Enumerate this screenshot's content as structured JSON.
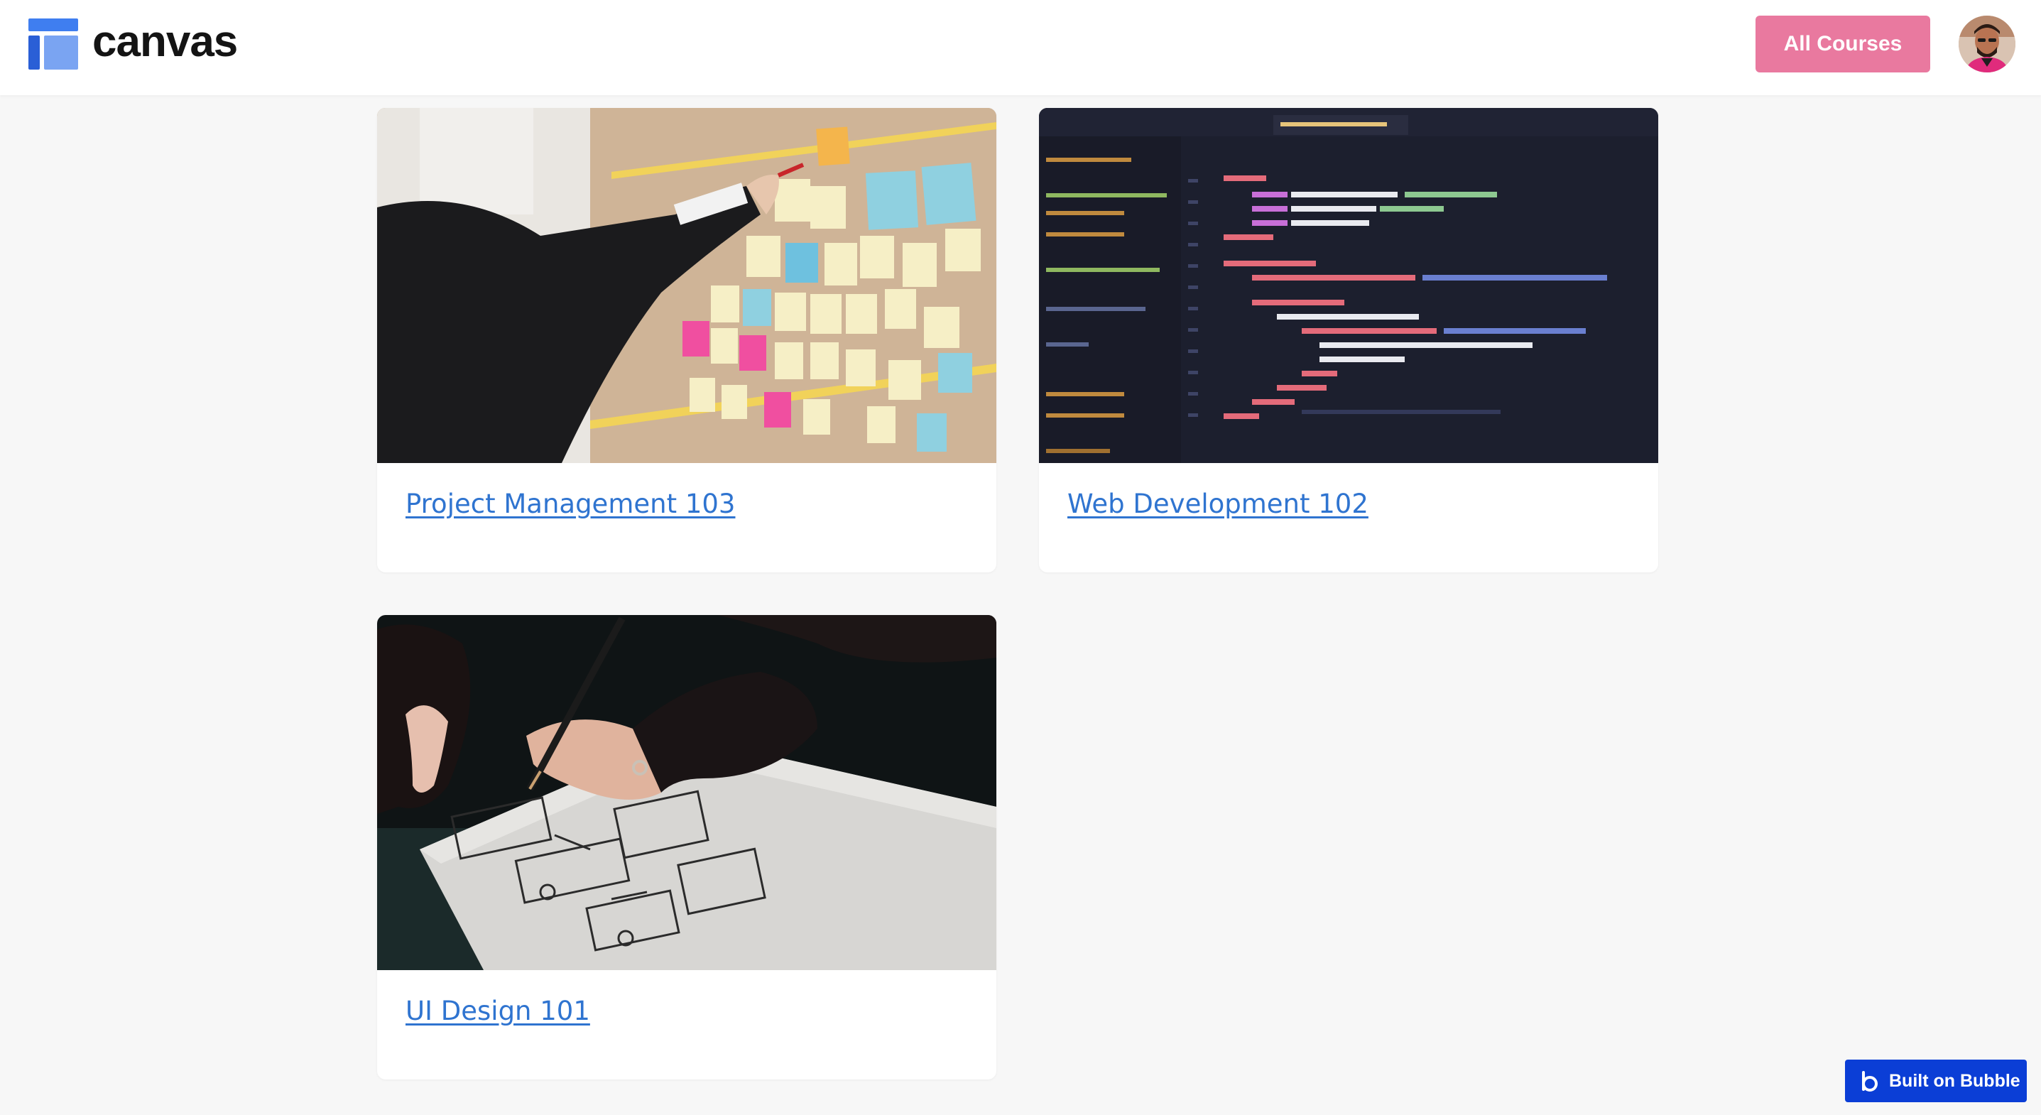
{
  "app": {
    "logo_text": "canvas",
    "brand_colors": {
      "logo_bar": "#3f7ef0",
      "logo_column": "#2a5fd6",
      "logo_block": "#7aa4f2",
      "accent_button": "#e9799f",
      "link": "#2f74d0",
      "bubble_badge": "#0b3ed6"
    }
  },
  "header": {
    "all_courses_label": "All Courses",
    "avatar_icon": "user-avatar"
  },
  "courses": [
    {
      "title": "Project Management 103",
      "image": "sticky-notes-board-photo"
    },
    {
      "title": "Web Development 102",
      "image": "code-editor-screen-photo"
    },
    {
      "title": "UI Design 101",
      "image": "hand-sketching-wireframe-photo"
    }
  ],
  "badge": {
    "label": "Built on Bubble",
    "icon": "bubble-logo-icon"
  }
}
